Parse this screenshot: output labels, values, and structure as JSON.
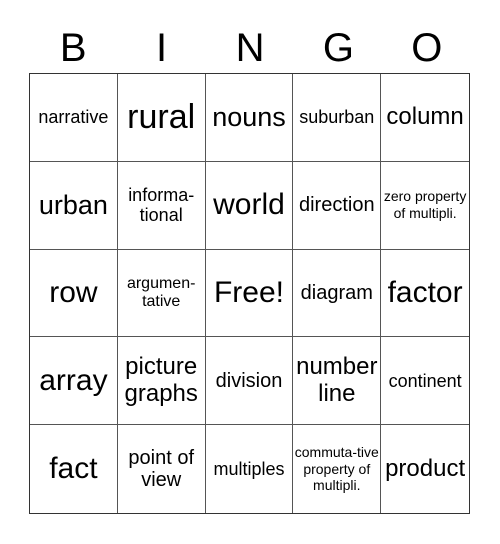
{
  "header": [
    "B",
    "I",
    "N",
    "G",
    "O"
  ],
  "cells": [
    {
      "text": "narrative",
      "size": "s-s"
    },
    {
      "text": "rural",
      "size": "s-xl"
    },
    {
      "text": "nouns",
      "size": "s-ml"
    },
    {
      "text": "suburban",
      "size": "s-s"
    },
    {
      "text": "column",
      "size": "s-m"
    },
    {
      "text": "urban",
      "size": "s-ml"
    },
    {
      "text": "informa-tional",
      "size": "s-s"
    },
    {
      "text": "world",
      "size": "s-l"
    },
    {
      "text": "direction",
      "size": "s-sm"
    },
    {
      "text": "zero property of multipli.",
      "size": "s-xxs"
    },
    {
      "text": "row",
      "size": "s-l"
    },
    {
      "text": "argumen-tative",
      "size": "s-xs"
    },
    {
      "text": "Free!",
      "size": "s-l"
    },
    {
      "text": "diagram",
      "size": "s-sm"
    },
    {
      "text": "factor",
      "size": "s-l"
    },
    {
      "text": "array",
      "size": "s-l"
    },
    {
      "text": "picture graphs",
      "size": "s-m"
    },
    {
      "text": "division",
      "size": "s-sm"
    },
    {
      "text": "number line",
      "size": "s-m"
    },
    {
      "text": "continent",
      "size": "s-s"
    },
    {
      "text": "fact",
      "size": "s-l"
    },
    {
      "text": "point of view",
      "size": "s-sm"
    },
    {
      "text": "multiples",
      "size": "s-s"
    },
    {
      "text": "commuta-tive property of multipli.",
      "size": "s-xxs"
    },
    {
      "text": "product",
      "size": "s-m"
    }
  ]
}
